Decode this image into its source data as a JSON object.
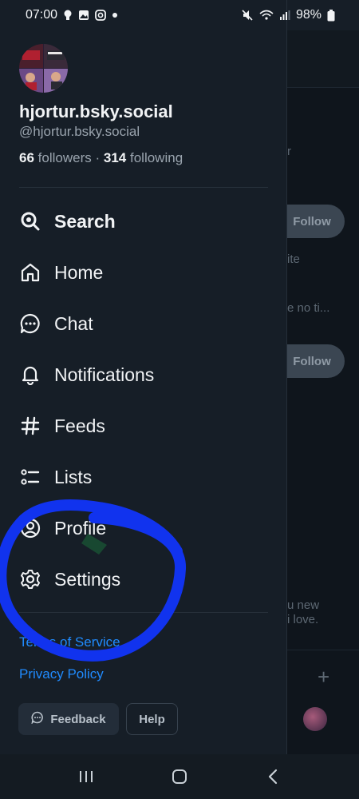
{
  "status": {
    "time": "07:00",
    "battery": "98%",
    "left_icons": [
      "bulb-icon",
      "image-icon",
      "instagram-icon",
      "dot-icon"
    ],
    "right_icons": [
      "mute-icon",
      "wifi-icon",
      "signal-icon",
      "battery-icon"
    ]
  },
  "profile": {
    "display_name": "hjortur.bsky.social",
    "handle": "@hjortur.bsky.social",
    "followers_count": "66",
    "followers_label": "followers",
    "separator": "·",
    "following_count": "314",
    "following_label": "following"
  },
  "nav": [
    {
      "label": "Search",
      "icon": "search-icon",
      "active": true
    },
    {
      "label": "Home",
      "icon": "home-icon"
    },
    {
      "label": "Chat",
      "icon": "chat-icon"
    },
    {
      "label": "Notifications",
      "icon": "bell-icon"
    },
    {
      "label": "Feeds",
      "icon": "hash-icon"
    },
    {
      "label": "Lists",
      "icon": "list-icon"
    },
    {
      "label": "Profile",
      "icon": "user-circle-icon"
    },
    {
      "label": "Settings",
      "icon": "gear-icon"
    }
  ],
  "links": {
    "terms": "Terms of Service",
    "privacy": "Privacy Policy"
  },
  "buttons": {
    "feedback": "Feedback",
    "help": "Help"
  },
  "background": {
    "text_1": "r",
    "follow_1": "Follow",
    "text_2": "ite",
    "text_3": "e no ti...",
    "follow_2": "Follow",
    "text_4": "u new",
    "text_5": "i love."
  },
  "colors": {
    "accent": "#208bfe",
    "drawer_bg": "#161e27",
    "annotation": "#1133ee"
  }
}
